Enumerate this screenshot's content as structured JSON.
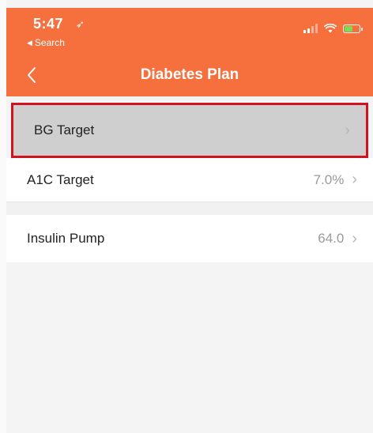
{
  "status_bar": {
    "time": "5:47",
    "location_icon": "location-arrow-icon",
    "back_label": "Search"
  },
  "nav": {
    "title": "Diabetes Plan",
    "back_icon": "chevron-left-icon"
  },
  "rows": [
    {
      "label": "BG Target",
      "value": ""
    },
    {
      "label": "A1C Target",
      "value": "7.0%"
    },
    {
      "label": "Insulin Pump",
      "value": "64.0"
    }
  ],
  "colors": {
    "header": "#f5703d",
    "highlight_border": "#d0141f",
    "selected_row": "#cfcfcf"
  }
}
